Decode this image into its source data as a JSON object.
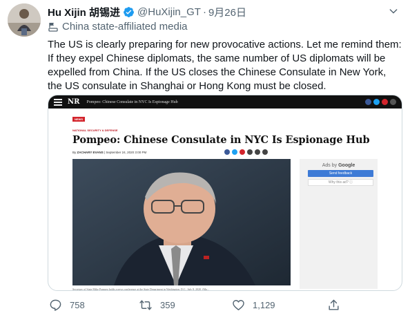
{
  "tweet": {
    "display_name": "Hu Xijin 胡锡进",
    "handle": "@HuXijin_GT",
    "separator": "·",
    "date": "9月26日",
    "affiliation": "China state-affiliated media",
    "text": "The US is clearly preparing for new provocative actions. Let me remind them: If they expel Chinese diplomats, the same number of US diplomats will be expelled from China. If the US closes the Chinese Consulate in New York, the US consulate in Shanghai or Hong Kong must be closed."
  },
  "embedded_article": {
    "site_logo": "NR",
    "bar_title": "Pompeo: Chinese Consulate in NYC Is Espionage Hub",
    "tag": "NEWS",
    "section": "NATIONAL SECURITY & DEFENSE",
    "headline": "Pompeo: Chinese Consulate in NYC Is Espionage Hub",
    "byline_prefix": "By",
    "author": "ZACHARY EVANS",
    "date": "September 24, 2020 3:00 PM",
    "caption": "Secretary of State Mike Pompeo holds a news conference at the State Department in Washington, D.C., July 8, 2020. (Ma...",
    "ad": {
      "ads_by_prefix": "Ads by",
      "ads_by_brand": "Google",
      "feedback_label": "Send feedback",
      "why_label": "Why this ad? ⓘ"
    }
  },
  "actions": {
    "replies": "758",
    "retweets": "359",
    "likes": "1,129"
  },
  "colors": {
    "verified": "#1d9bf0",
    "muted_text": "#536471",
    "nr_red": "#d3242c",
    "ad_blue": "#3e7bd6"
  }
}
